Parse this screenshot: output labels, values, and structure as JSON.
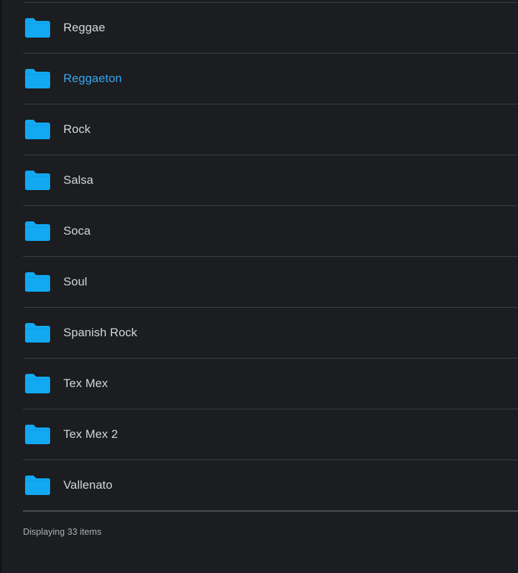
{
  "folders": [
    {
      "label": "Reggae",
      "active": false
    },
    {
      "label": "Reggaeton",
      "active": true
    },
    {
      "label": "Rock",
      "active": false
    },
    {
      "label": "Salsa",
      "active": false
    },
    {
      "label": "Soca",
      "active": false
    },
    {
      "label": "Soul",
      "active": false
    },
    {
      "label": "Spanish Rock",
      "active": false
    },
    {
      "label": "Tex Mex",
      "active": false
    },
    {
      "label": "Tex Mex 2",
      "active": false
    },
    {
      "label": "Vallenato",
      "active": false
    }
  ],
  "footer": {
    "status_text": "Displaying 33 items"
  },
  "colors": {
    "folder_icon": "#12a8f2",
    "active_label": "#3aa8f0",
    "background": "#1b1d20"
  },
  "icon": "folder-icon"
}
